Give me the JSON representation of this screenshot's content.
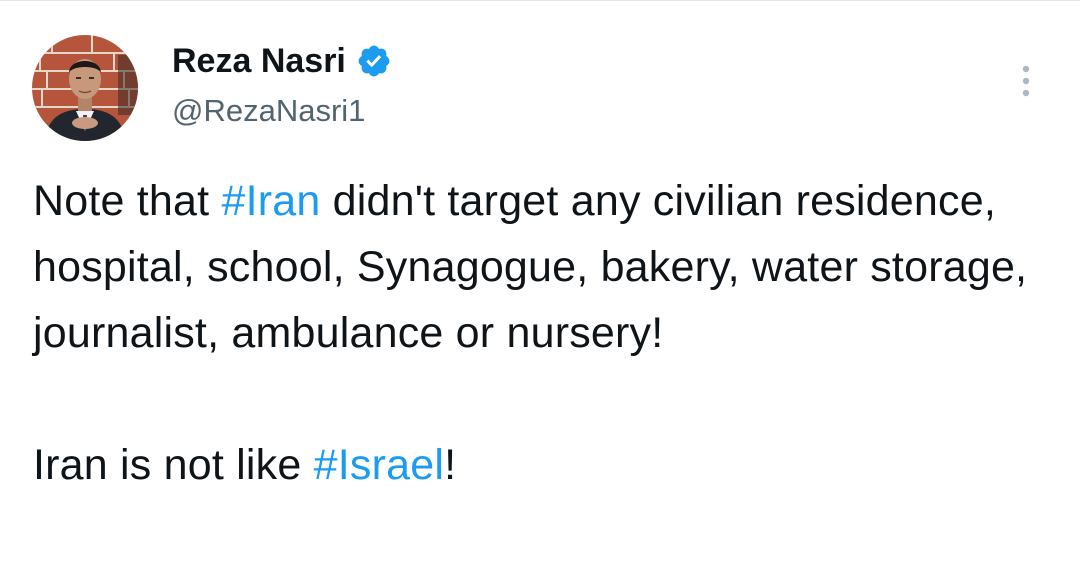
{
  "author": {
    "display_name": "Reza Nasri",
    "handle": "@RezaNasri1",
    "verified_icon": "verified-badge-icon",
    "avatar_icon": "profile-photo"
  },
  "menu": {
    "icon": "more-vertical-icon"
  },
  "tweet": {
    "p1_part1": "Note that ",
    "p1_hashtag": "#Iran",
    "p1_part2": " didn't target any civilian residence, hospital, school, Synagogue, bakery, water storage, journalist, ambulance or nursery!",
    "p2_part1": "Iran is not like ",
    "p2_hashtag": "#Israel",
    "p2_part2": "!"
  },
  "colors": {
    "hashtag": "#1d9bf0",
    "verified": "#1d9bf0",
    "text": "#0f1419",
    "secondary_text": "#536471"
  }
}
